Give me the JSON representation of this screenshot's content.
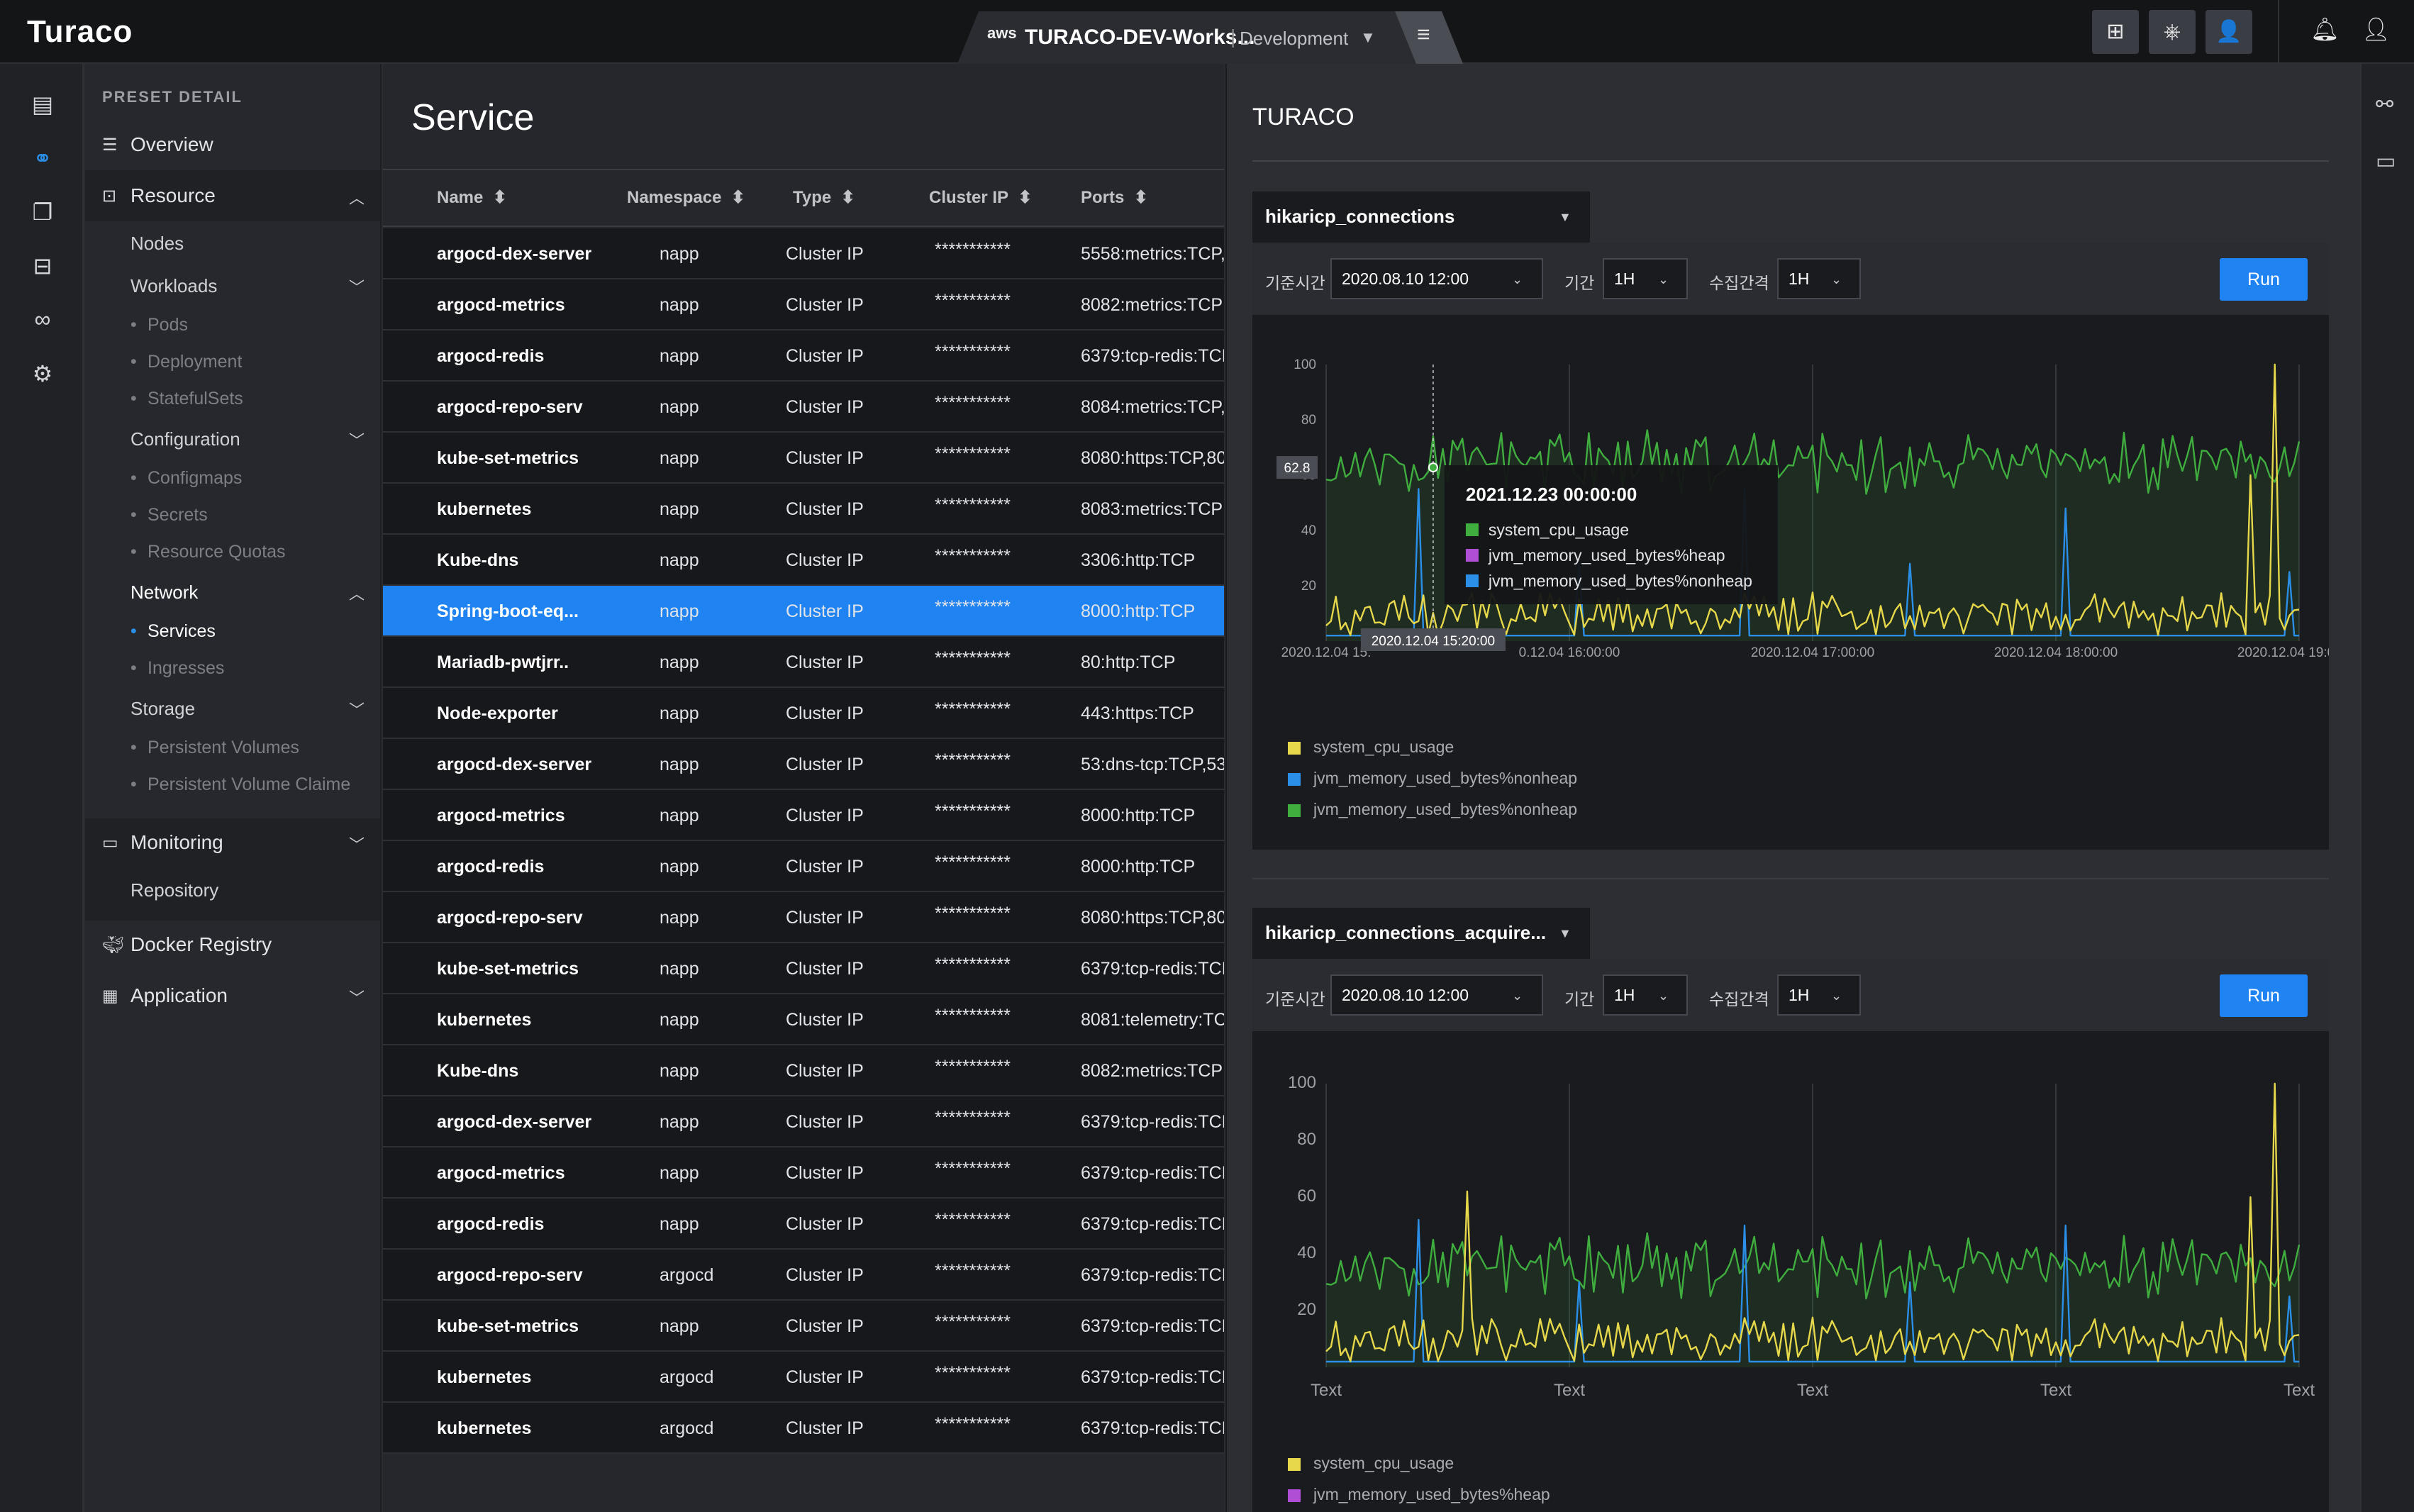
{
  "app": {
    "logo": "Turaco",
    "workspace": {
      "aws": "aws",
      "name": "TURACO-DEV-Works...",
      "separator": "|",
      "env": "Development"
    }
  },
  "icons": {
    "top": [
      "topology-icon",
      "helm-icon",
      "user-admin-icon",
      "bell-icon",
      "profile-icon"
    ],
    "rail": [
      "dashboard-icon",
      "resource-icon",
      "library-icon",
      "topology-icon",
      "pipeline-icon",
      "settings-icon"
    ],
    "right_rail": [
      "connection-icon",
      "monitor-icon"
    ]
  },
  "nav": {
    "header": "PRESET DETAIL",
    "overview": "Overview",
    "resource": "Resource",
    "nodes": "Nodes",
    "workloads": "Workloads",
    "pods": "Pods",
    "deployment": "Deployment",
    "statefulsets": "StatefulSets",
    "configuration": "Configuration",
    "configmaps": "Configmaps",
    "secrets": "Secrets",
    "resource_quotas": "Resource Quotas",
    "network": "Network",
    "services": "Services",
    "ingresses": "Ingresses",
    "storage": "Storage",
    "persistent_volumes": "Persistent Volumes",
    "persistent_volume_claims": "Persistent Volume Claime",
    "monitoring": "Monitoring",
    "repository": "Repository",
    "docker_registry": "Docker Registry",
    "application": "Application"
  },
  "page": {
    "title": "Service"
  },
  "table": {
    "headers": {
      "name": "Name",
      "namespace": "Namespace",
      "type": "Type",
      "cluster_ip": "Cluster IP",
      "ports": "Ports"
    },
    "rows": [
      {
        "name": "argocd-dex-server",
        "ns": "napp",
        "type": "Cluster IP",
        "ip": "***********",
        "ports": "5558:metrics:TCP,5"
      },
      {
        "name": "argocd-metrics",
        "ns": "napp",
        "type": "Cluster IP",
        "ip": "***********",
        "ports": "8082:metrics:TCP"
      },
      {
        "name": "argocd-redis",
        "ns": "napp",
        "type": "Cluster IP",
        "ip": "***********",
        "ports": "6379:tcp-redis:TCP"
      },
      {
        "name": "argocd-repo-serv",
        "ns": "napp",
        "type": "Cluster IP",
        "ip": "***********",
        "ports": "8084:metrics:TCP,8"
      },
      {
        "name": "kube-set-metrics",
        "ns": "napp",
        "type": "Cluster IP",
        "ip": "***********",
        "ports": "8080:https:TCP,808"
      },
      {
        "name": "kubernetes",
        "ns": "napp",
        "type": "Cluster IP",
        "ip": "***********",
        "ports": "8083:metrics:TCP"
      },
      {
        "name": "Kube-dns",
        "ns": "napp",
        "type": "Cluster IP",
        "ip": "***********",
        "ports": "3306:http:TCP"
      },
      {
        "name": "Spring-boot-eq...",
        "ns": "napp",
        "type": "Cluster IP",
        "ip": "***********",
        "ports": "8000:http:TCP",
        "selected": true
      },
      {
        "name": "Mariadb-pwtjrr..",
        "ns": "napp",
        "type": "Cluster IP",
        "ip": "***********",
        "ports": "80:http:TCP"
      },
      {
        "name": "Node-exporter",
        "ns": "napp",
        "type": "Cluster IP",
        "ip": "***********",
        "ports": "443:https:TCP"
      },
      {
        "name": "argocd-dex-server",
        "ns": "napp",
        "type": "Cluster IP",
        "ip": "***********",
        "ports": "53:dns-tcp:TCP,53:"
      },
      {
        "name": "argocd-metrics",
        "ns": "napp",
        "type": "Cluster IP",
        "ip": "***********",
        "ports": "8000:http:TCP"
      },
      {
        "name": "argocd-redis",
        "ns": "napp",
        "type": "Cluster IP",
        "ip": "***********",
        "ports": "8000:http:TCP"
      },
      {
        "name": "argocd-repo-serv",
        "ns": "napp",
        "type": "Cluster IP",
        "ip": "***********",
        "ports": "8080:https:TCP,808"
      },
      {
        "name": "kube-set-metrics",
        "ns": "napp",
        "type": "Cluster IP",
        "ip": "***********",
        "ports": "6379:tcp-redis:TCP"
      },
      {
        "name": "kubernetes",
        "ns": "napp",
        "type": "Cluster IP",
        "ip": "***********",
        "ports": "8081:telemetry:TC"
      },
      {
        "name": "Kube-dns",
        "ns": "napp",
        "type": "Cluster IP",
        "ip": "***********",
        "ports": "8082:metrics:TCP"
      },
      {
        "name": "argocd-dex-server",
        "ns": "napp",
        "type": "Cluster IP",
        "ip": "***********",
        "ports": "6379:tcp-redis:TCP"
      },
      {
        "name": "argocd-metrics",
        "ns": "napp",
        "type": "Cluster IP",
        "ip": "***********",
        "ports": "6379:tcp-redis:TCP"
      },
      {
        "name": "argocd-redis",
        "ns": "napp",
        "type": "Cluster IP",
        "ip": "***********",
        "ports": "6379:tcp-redis:TCP"
      },
      {
        "name": "argocd-repo-serv",
        "ns": "argocd",
        "type": "Cluster IP",
        "ip": "***********",
        "ports": "6379:tcp-redis:TCP"
      },
      {
        "name": "kube-set-metrics",
        "ns": "napp",
        "type": "Cluster IP",
        "ip": "***********",
        "ports": "6379:tcp-redis:TCP"
      },
      {
        "name": "kubernetes",
        "ns": "argocd",
        "type": "Cluster IP",
        "ip": "***********",
        "ports": "6379:tcp-redis:TCP"
      },
      {
        "name": "kubernetes",
        "ns": "argocd",
        "type": "Cluster IP",
        "ip": "***********",
        "ports": "6379:tcp-redis:TCP"
      }
    ]
  },
  "detail": {
    "title": "TURACO",
    "controls": {
      "base_time_label": "기준시간",
      "base_time": "2020.08.10 12:00",
      "period_label": "기간",
      "period": "1H",
      "interval_label": "수집간격",
      "interval": "1H",
      "run": "Run"
    }
  },
  "colors": {
    "accent": "#1f83f2",
    "yellow": "#e6d84a",
    "blue": "#2b8fe8",
    "green": "#3fae3f",
    "purple": "#b04fd6"
  },
  "chart_data": [
    {
      "type": "line",
      "title": "hikaricp_connections",
      "ylim": [
        0,
        100
      ],
      "yticks": [
        "100",
        "80",
        "60",
        "40",
        "20"
      ],
      "xticks": [
        "2020.12.04 15:",
        "0.12.04 16:00:00",
        "2020.12.04 17:00:00",
        "2020.12.04 18:00:00",
        "2020.12.04 19:00:00"
      ],
      "series": [
        {
          "name": "system_cpu_usage",
          "color": "#e6d84a",
          "baseline": 8,
          "amp": 6,
          "spikes": [
            [
              0.973,
              100
            ],
            [
              0.952,
              60
            ]
          ]
        },
        {
          "name": "jvm_memory_used_bytes%nonheap",
          "color": "#2b8fe8",
          "baseline": 2,
          "amp": 0,
          "spikes": [
            [
              0.095,
              55
            ],
            [
              0.26,
              28
            ],
            [
              0.43,
              55
            ],
            [
              0.6,
              28
            ],
            [
              0.76,
              48
            ],
            [
              0.99,
              25
            ]
          ]
        },
        {
          "name": "jvm_memory_used_bytes%nonheap",
          "color": "#3fae3f",
          "baseline": 62,
          "amp": 9,
          "spikes": []
        }
      ],
      "cursor": {
        "label": "62.8",
        "time": "2020.12.04 15:20:00"
      },
      "tooltip": {
        "title": "2021.12.23 00:00:00",
        "items": [
          {
            "name": "system_cpu_usage",
            "color": "#3fae3f"
          },
          {
            "name": "jvm_memory_used_bytes%heap",
            "color": "#b04fd6"
          },
          {
            "name": "jvm_memory_used_bytes%nonheap",
            "color": "#2b8fe8"
          }
        ]
      },
      "legend": [
        {
          "name": "system_cpu_usage",
          "color": "#e6d84a"
        },
        {
          "name": "jvm_memory_used_bytes%nonheap",
          "color": "#2b8fe8"
        },
        {
          "name": "jvm_memory_used_bytes%nonheap",
          "color": "#3fae3f"
        }
      ]
    },
    {
      "type": "line",
      "title": "hikaricp_connections_acquire...",
      "ylim": [
        0,
        100
      ],
      "yticks": [
        "100",
        "80",
        "60",
        "40",
        "20"
      ],
      "xticks": [
        "Text",
        "Text",
        "Text",
        "Text",
        "Text"
      ],
      "series": [
        {
          "name": "system_cpu_usage",
          "color": "#e6d84a",
          "baseline": 8,
          "amp": 6,
          "spikes": [
            [
              0.143,
              62
            ],
            [
              0.973,
              100
            ],
            [
              0.952,
              60
            ]
          ]
        },
        {
          "name": "jvm_memory_used_bytes%heap",
          "color": "#2b8fe8",
          "baseline": 2,
          "amp": 0,
          "spikes": [
            [
              0.095,
              52
            ],
            [
              0.26,
              30
            ],
            [
              0.43,
              50
            ],
            [
              0.6,
              30
            ],
            [
              0.76,
              50
            ],
            [
              0.99,
              25
            ]
          ]
        },
        {
          "name": "jvm_memory_used_bytes%nonheap",
          "color": "#3fae3f",
          "baseline": 33,
          "amp": 9,
          "spikes": []
        }
      ],
      "legend": [
        {
          "name": "system_cpu_usage",
          "color": "#e6d84a"
        },
        {
          "name": "jvm_memory_used_bytes%heap",
          "color": "#b04fd6"
        }
      ]
    }
  ]
}
